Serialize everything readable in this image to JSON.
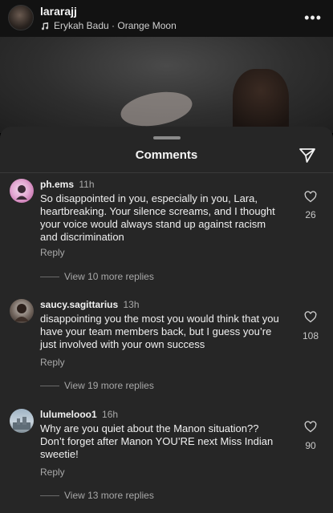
{
  "post": {
    "username": "lararajj",
    "music": "Erykah Badu · Orange Moon"
  },
  "comments_sheet": {
    "title": "Comments"
  },
  "comments": [
    {
      "user": "ph.ems",
      "time": "11h",
      "text": "So disappointed in you, especially in you, Lara, heartbreaking. Your silence screams, and I thought your voice would always stand up against racism and discrimination",
      "reply_label": "Reply",
      "view_replies": "View 10 more replies",
      "likes": "26"
    },
    {
      "user": "saucy.sagittarius",
      "time": "13h",
      "text": "disappointing you the most you would think that you have your team members back, but I guess you’re just involved with your own success",
      "reply_label": "Reply",
      "view_replies": "View 19 more replies",
      "likes": "108"
    },
    {
      "user": "lulumelooo1",
      "time": "16h",
      "text": "Why are you quiet about the Manon situation?? Don’t forget after Manon YOU’RE next Miss Indian sweetie!",
      "reply_label": "Reply",
      "view_replies": "View 13 more replies",
      "likes": "90"
    }
  ],
  "colors": {
    "sheet_bg": "#262626",
    "page_bg": "#000000",
    "muted_text": "#a8a8a8"
  }
}
